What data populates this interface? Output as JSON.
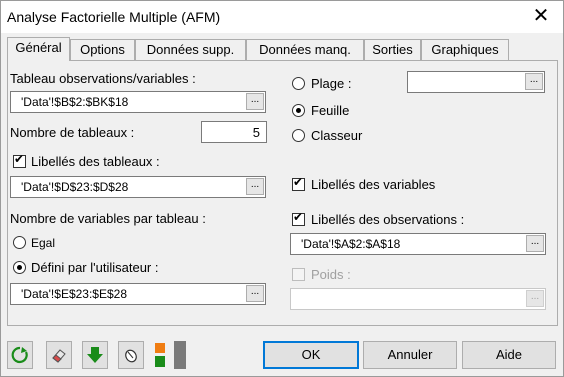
{
  "window": {
    "title": "Analyse Factorielle Multiple (AFM)",
    "close_label": "✕"
  },
  "tabs": [
    {
      "label": "Général",
      "active": true
    },
    {
      "label": "Options"
    },
    {
      "label": "Données supp."
    },
    {
      "label": "Données manq."
    },
    {
      "label": "Sorties"
    },
    {
      "label": "Graphiques"
    }
  ],
  "general": {
    "table_label": "Tableau observations/variables :",
    "table_value": "'Data'!$B$2:$BK$18",
    "num_tables_label": "Nombre de tableaux :",
    "num_tables_value": "5",
    "table_labels_label": "Libellés des tableaux :",
    "table_labels_checked": true,
    "table_labels_value": "'Data'!$D$23:$D$28",
    "vars_per_table_label": "Nombre de variables par tableau :",
    "equal_label": "Egal",
    "user_defined_label": "Défini par l'utilisateur :",
    "user_defined_value": "'Data'!$E$23:$E$28",
    "range_label": "Plage :",
    "range_value": "",
    "sheet_label": "Feuille",
    "workbook_label": "Classeur",
    "var_labels_label": "Libellés des variables",
    "var_labels_checked": true,
    "obs_labels_label": "Libellés des observations :",
    "obs_labels_checked": true,
    "obs_labels_value": "'Data'!$A$2:$A$18",
    "weights_label": "Poids :",
    "weights_value": ""
  },
  "ref_button_label": "...",
  "buttons": {
    "ok": "OK",
    "cancel": "Annuler",
    "help": "Aide"
  },
  "icons": [
    "reset-icon",
    "eraser-icon",
    "down-arrow-icon",
    "mouse-icon",
    "layout-toggle-icon"
  ],
  "colors": {
    "accent": "#0078d7",
    "green": "#1a8c1a",
    "orange": "#f07d12"
  }
}
